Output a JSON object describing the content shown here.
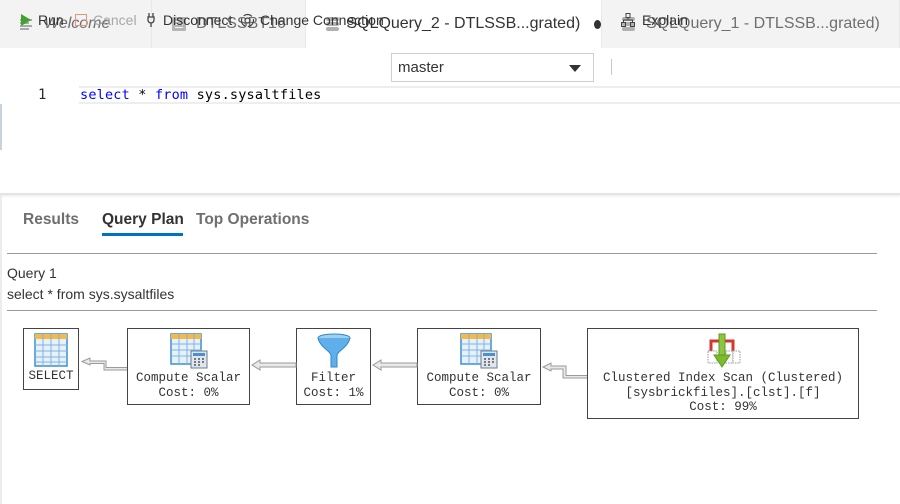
{
  "tabs": [
    {
      "label": "Welcome",
      "icon": "welcome-lines-icon",
      "active": false
    },
    {
      "label": "DTLSSBT16",
      "icon": "document-icon",
      "active": false
    },
    {
      "label": "SQLQuery_2 - DTLSSB...grated)",
      "icon": "database-icon",
      "active": true,
      "dirty": true
    },
    {
      "label": "SQLQuery_1 - DTLSSB...grated)",
      "icon": "database-icon",
      "active": false
    }
  ],
  "toolbar": {
    "run_label": "Run",
    "cancel_label": "Cancel",
    "disconnect_label": "Disconnect",
    "change_connection_label": "Change Connection",
    "database_selected": "master",
    "explain_label": "Explain"
  },
  "editor": {
    "line_number": "1",
    "code_tokens": [
      {
        "text": "select",
        "kw": true
      },
      {
        "text": " * ",
        "kw": false
      },
      {
        "text": "from",
        "kw": true
      },
      {
        "text": " sys.sysaltfiles",
        "kw": false
      }
    ]
  },
  "results": {
    "tabs": [
      {
        "label": "Results",
        "active": false
      },
      {
        "label": "Query Plan",
        "active": true
      },
      {
        "label": "Top Operations",
        "active": false
      }
    ],
    "query_title": "Query 1",
    "query_sql": "select * from sys.sysaltfiles",
    "plan_nodes": [
      {
        "name": "SELECT",
        "detail": "",
        "cost": "",
        "icon": "select-table-icon"
      },
      {
        "name": "Compute Scalar",
        "detail": "",
        "cost": "Cost: 0%",
        "icon": "compute-scalar-icon"
      },
      {
        "name": "Filter",
        "detail": "",
        "cost": "Cost: 1%",
        "icon": "filter-funnel-icon"
      },
      {
        "name": "Compute Scalar",
        "detail": "",
        "cost": "Cost: 0%",
        "icon": "compute-scalar-icon"
      },
      {
        "name": "Clustered Index Scan (Clustered)",
        "detail": "[sysbrickfiles].[clst].[f]",
        "cost": "Cost: 99%",
        "icon": "clustered-index-scan-icon"
      }
    ]
  },
  "colors": {
    "accent": "#0072c6",
    "run_green": "#3fa32f",
    "cancel_orange": "#e8937c",
    "keyword_blue": "#0000ff"
  }
}
